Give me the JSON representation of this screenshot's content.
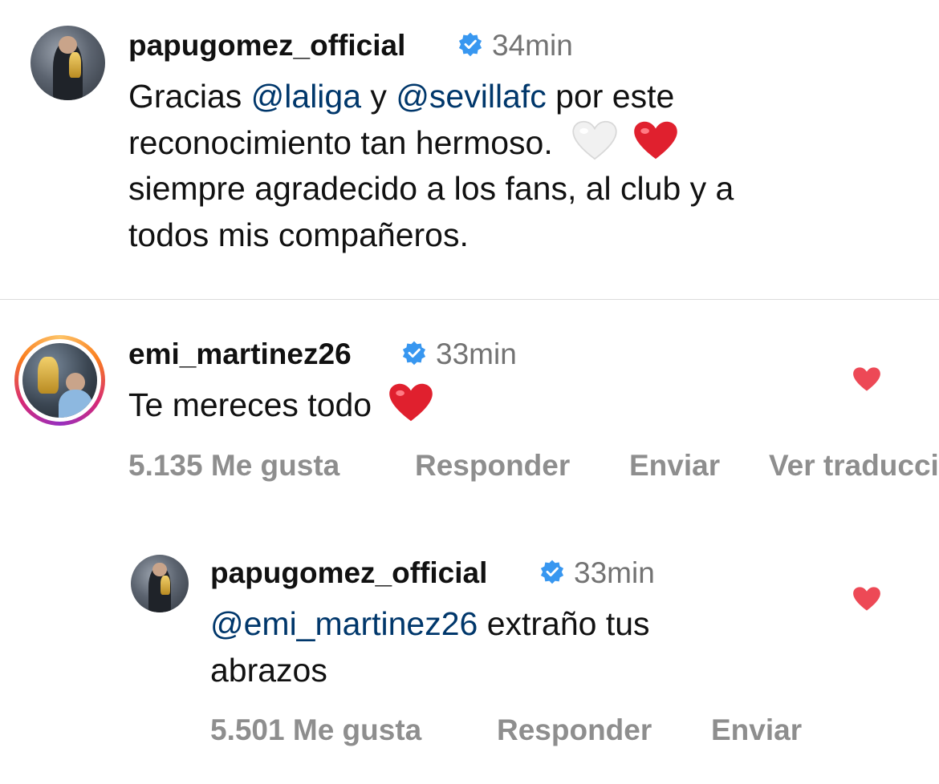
{
  "caption": {
    "username": "papugomez_official",
    "time": "34min",
    "text_part1": "Gracias ",
    "mention1": "@laliga",
    "text_part2": " y ",
    "mention2": "@sevillafc",
    "text_part3": " por este",
    "line2": "reconocimiento tan hermoso.",
    "line3": "siempre agradecido a los fans, al club y a",
    "line4": "todos mis compañeros."
  },
  "comments": [
    {
      "username": "emi_martinez26",
      "time": "33min",
      "text": "Te mereces todo",
      "likes": "5.135 Me gusta",
      "reply": "Responder",
      "send": "Enviar",
      "translate": "Ver traducción",
      "liked": true
    },
    {
      "username": "papugomez_official",
      "time": "33min",
      "mention": "@emi_martinez26",
      "text_line1": " extraño tus",
      "text_line2": "abrazos",
      "likes": "5.501 Me gusta",
      "reply": "Responder",
      "send": "Enviar",
      "liked": true
    }
  ],
  "colors": {
    "mention": "#00376b",
    "verified": "#3897f0",
    "like_heart": "#ed4956",
    "meta_text": "#8e8e8e"
  },
  "icons": [
    "verified-badge-icon",
    "white-heart-emoji",
    "red-heart-emoji",
    "like-heart-icon"
  ]
}
